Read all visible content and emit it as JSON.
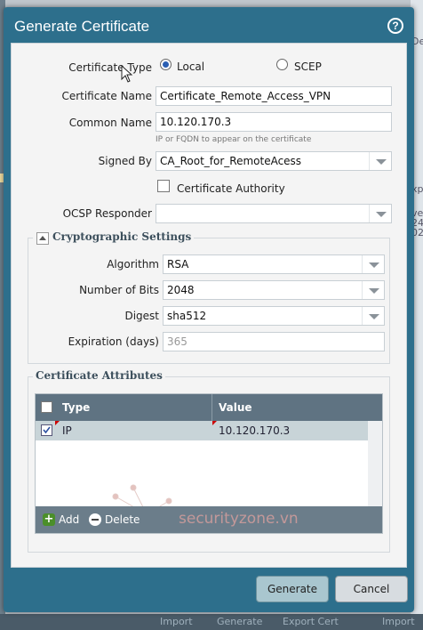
{
  "dialog": {
    "title": "Generate Certificate",
    "help_icon": "?"
  },
  "form": {
    "certificate_type_label": "Certificate Type",
    "type_options": [
      {
        "label": "Local",
        "selected": true
      },
      {
        "label": "SCEP",
        "selected": false
      }
    ],
    "certificate_name_label": "Certificate Name",
    "certificate_name_value": "Certificate_Remote_Access_VPN",
    "common_name_label": "Common Name",
    "common_name_value": "10.120.170.3",
    "common_name_hint": "IP or FQDN to appear on the certificate",
    "signed_by_label": "Signed By",
    "signed_by_value": "CA_Root_for_RemoteAcess",
    "certificate_authority_label": "Certificate Authority",
    "certificate_authority_checked": false,
    "ocsp_responder_label": "OCSP Responder",
    "ocsp_responder_value": ""
  },
  "crypto": {
    "legend": "Cryptographic Settings",
    "algorithm_label": "Algorithm",
    "algorithm_value": "RSA",
    "bits_label": "Number of Bits",
    "bits_value": "2048",
    "digest_label": "Digest",
    "digest_value": "sha512",
    "expiration_label": "Expiration (days)",
    "expiration_placeholder": "365"
  },
  "attributes": {
    "legend": "Certificate Attributes",
    "columns": [
      "Type",
      "Value"
    ],
    "rows": [
      {
        "type": "IP",
        "value": "10.120.170.3",
        "checked": true
      }
    ],
    "add_label": "Add",
    "delete_label": "Delete"
  },
  "watermark": "securityzone.vn",
  "buttons": {
    "generate": "Generate",
    "cancel": "Cancel"
  },
  "background": {
    "right_fragments": [
      "De",
      "xp",
      "ve",
      "24",
      "02"
    ],
    "bottom_fragments": [
      "Import",
      "Generate",
      "Export Cert",
      "Import"
    ]
  }
}
